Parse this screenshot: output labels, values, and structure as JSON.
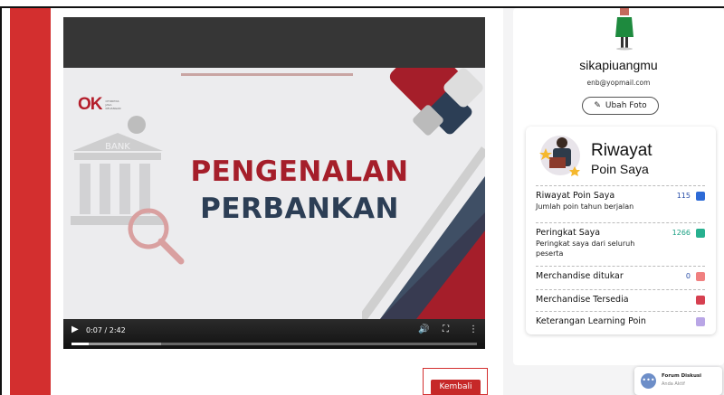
{
  "video": {
    "slide_title_line1": "PENGENALAN",
    "slide_title_line2": "PERBANKAN",
    "logo_mark": "OK",
    "logo_text": "OTORITAS JASA KEUANGAN",
    "bank_sign": "BANK",
    "time": "0:07 / 2:42",
    "progress": 0.043,
    "buffered": 0.22
  },
  "back_button": "Kembali",
  "profile": {
    "username": "sikapiuangmu",
    "email": "enb@yopmail.com",
    "change_photo": "Ubah Foto"
  },
  "riwayat": {
    "title": "Riwayat",
    "subtitle": "Poin Saya",
    "rows": [
      {
        "label": "Riwayat Poin Saya",
        "desc": "Jumlah poin tahun berjalan",
        "value": "115",
        "value_color": "#2a4fa8",
        "icon": "chart-icon",
        "icon_color": "#2d6ad6"
      },
      {
        "label": "Peringkat Saya",
        "desc": "Peringkat saya dari seluruh peserta",
        "value": "1266",
        "value_color": "#1aa083",
        "icon": "star-icon",
        "icon_color": "#27b08f"
      },
      {
        "label": "Merchandise ditukar",
        "desc": "",
        "value": "0",
        "value_color": "#2a4fa8",
        "icon": "gift-icon",
        "icon_color": "#f08080"
      },
      {
        "label": "Merchandise Tersedia",
        "desc": "",
        "value": "",
        "value_color": "#2a4fa8",
        "icon": "heart-icon",
        "icon_color": "#d64050"
      },
      {
        "label": "Keterangan Learning Poin",
        "desc": "",
        "value": "",
        "value_color": "#2a4fa8",
        "icon": "document-icon",
        "icon_color": "#b9a6e6"
      }
    ]
  },
  "forum": {
    "title": "Forum Diskusi",
    "subtitle": "Anda Aktif"
  },
  "colors": {
    "accent_red": "#d32f2f",
    "slide_red": "#a51e2a",
    "slide_navy": "#2c3e55"
  }
}
